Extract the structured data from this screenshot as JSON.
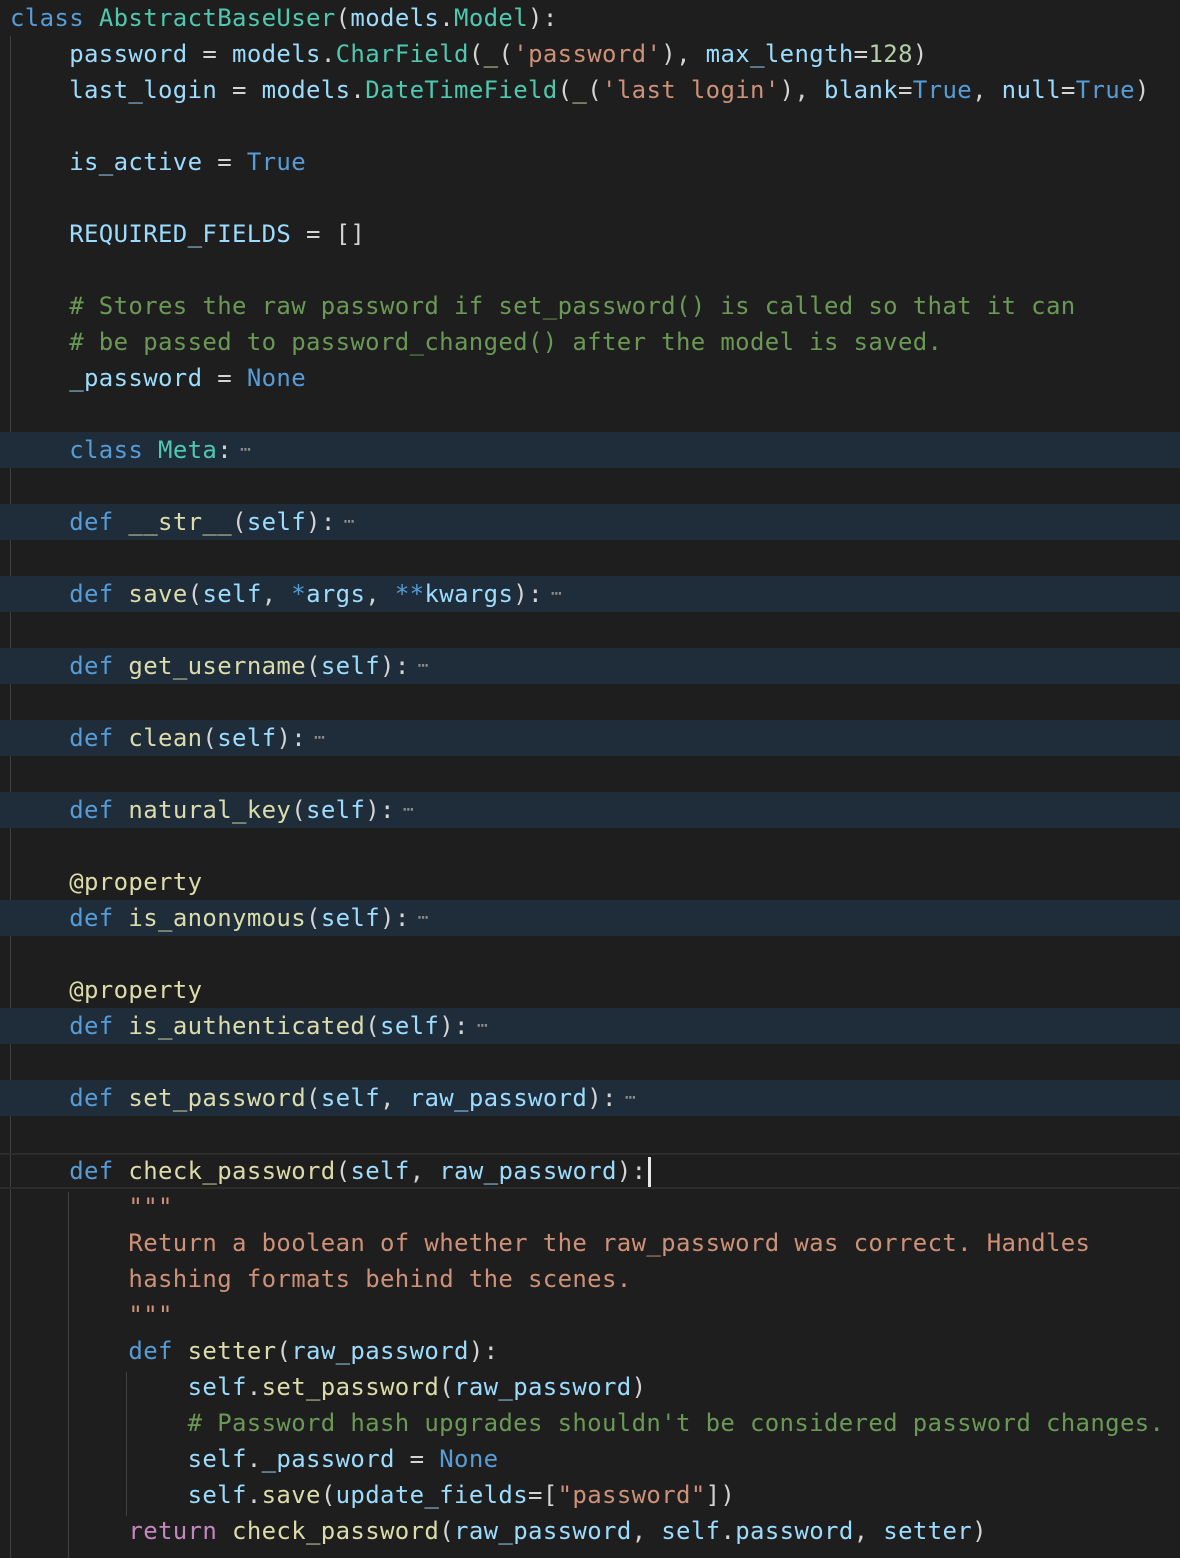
{
  "editor": {
    "language": "python",
    "theme": {
      "background": "#1e1e1e",
      "folded_highlight": "#1f2c3a",
      "keyword": "#569cd6",
      "class_name": "#4ec9b0",
      "function": "#dcdcaa",
      "variable": "#9cdcfe",
      "string": "#ce9178",
      "number": "#b5cea8",
      "comment": "#6a9955",
      "control": "#c586c0"
    },
    "fold_marker": "⋯",
    "lines": [
      {
        "tokens": [
          [
            "kw",
            "class"
          ],
          [
            "punc",
            " "
          ],
          [
            "cls",
            "AbstractBaseUser"
          ],
          [
            "punc",
            "("
          ],
          [
            "var",
            "models"
          ],
          [
            "punc",
            "."
          ],
          [
            "cls",
            "Model"
          ],
          [
            "punc",
            "):"
          ]
        ]
      },
      {
        "tokens": [
          [
            "punc",
            "    "
          ],
          [
            "var",
            "password"
          ],
          [
            "punc",
            " = "
          ],
          [
            "var",
            "models"
          ],
          [
            "punc",
            "."
          ],
          [
            "cls",
            "CharField"
          ],
          [
            "punc",
            "("
          ],
          [
            "fn",
            "_"
          ],
          [
            "punc",
            "("
          ],
          [
            "str",
            "'password'"
          ],
          [
            "punc",
            "), "
          ],
          [
            "var",
            "max_length"
          ],
          [
            "punc",
            "="
          ],
          [
            "num",
            "128"
          ],
          [
            "punc",
            ")"
          ]
        ]
      },
      {
        "tokens": [
          [
            "punc",
            "    "
          ],
          [
            "var",
            "last_login"
          ],
          [
            "punc",
            " = "
          ],
          [
            "var",
            "models"
          ],
          [
            "punc",
            "."
          ],
          [
            "cls",
            "DateTimeField"
          ],
          [
            "punc",
            "("
          ],
          [
            "fn",
            "_"
          ],
          [
            "punc",
            "("
          ],
          [
            "str",
            "'last login'"
          ],
          [
            "punc",
            "), "
          ],
          [
            "var",
            "blank"
          ],
          [
            "punc",
            "="
          ],
          [
            "kw",
            "True"
          ],
          [
            "punc",
            ", "
          ],
          [
            "var",
            "null"
          ],
          [
            "punc",
            "="
          ],
          [
            "kw",
            "True"
          ],
          [
            "punc",
            ")"
          ]
        ]
      },
      {
        "tokens": []
      },
      {
        "tokens": [
          [
            "punc",
            "    "
          ],
          [
            "var",
            "is_active"
          ],
          [
            "punc",
            " = "
          ],
          [
            "kw",
            "True"
          ]
        ]
      },
      {
        "tokens": []
      },
      {
        "tokens": [
          [
            "punc",
            "    "
          ],
          [
            "var",
            "REQUIRED_FIELDS"
          ],
          [
            "punc",
            " = []"
          ]
        ]
      },
      {
        "tokens": []
      },
      {
        "tokens": [
          [
            "punc",
            "    "
          ],
          [
            "com",
            "# Stores the raw password if set_password() is called so that it can"
          ]
        ]
      },
      {
        "tokens": [
          [
            "punc",
            "    "
          ],
          [
            "com",
            "# be passed to password_changed() after the model is saved."
          ]
        ]
      },
      {
        "tokens": [
          [
            "punc",
            "    "
          ],
          [
            "var",
            "_password"
          ],
          [
            "punc",
            " = "
          ],
          [
            "kw",
            "None"
          ]
        ]
      },
      {
        "tokens": []
      },
      {
        "folded": true,
        "tokens": [
          [
            "punc",
            "    "
          ],
          [
            "kw",
            "class"
          ],
          [
            "punc",
            " "
          ],
          [
            "cls",
            "Meta"
          ],
          [
            "punc",
            ":"
          ]
        ]
      },
      {
        "tokens": []
      },
      {
        "folded": true,
        "tokens": [
          [
            "punc",
            "    "
          ],
          [
            "kw",
            "def"
          ],
          [
            "punc",
            " "
          ],
          [
            "fn",
            "__str__"
          ],
          [
            "punc",
            "("
          ],
          [
            "var",
            "self"
          ],
          [
            "punc",
            "):"
          ]
        ]
      },
      {
        "tokens": []
      },
      {
        "folded": true,
        "tokens": [
          [
            "punc",
            "    "
          ],
          [
            "kw",
            "def"
          ],
          [
            "punc",
            " "
          ],
          [
            "fn",
            "save"
          ],
          [
            "punc",
            "("
          ],
          [
            "var",
            "self"
          ],
          [
            "punc",
            ", "
          ],
          [
            "kw",
            "*"
          ],
          [
            "var",
            "args"
          ],
          [
            "punc",
            ", "
          ],
          [
            "kw",
            "**"
          ],
          [
            "var",
            "kwargs"
          ],
          [
            "punc",
            "):"
          ]
        ]
      },
      {
        "tokens": []
      },
      {
        "folded": true,
        "tokens": [
          [
            "punc",
            "    "
          ],
          [
            "kw",
            "def"
          ],
          [
            "punc",
            " "
          ],
          [
            "fn",
            "get_username"
          ],
          [
            "punc",
            "("
          ],
          [
            "var",
            "self"
          ],
          [
            "punc",
            "):"
          ]
        ]
      },
      {
        "tokens": []
      },
      {
        "folded": true,
        "tokens": [
          [
            "punc",
            "    "
          ],
          [
            "kw",
            "def"
          ],
          [
            "punc",
            " "
          ],
          [
            "fn",
            "clean"
          ],
          [
            "punc",
            "("
          ],
          [
            "var",
            "self"
          ],
          [
            "punc",
            "):"
          ]
        ]
      },
      {
        "tokens": []
      },
      {
        "folded": true,
        "tokens": [
          [
            "punc",
            "    "
          ],
          [
            "kw",
            "def"
          ],
          [
            "punc",
            " "
          ],
          [
            "fn",
            "natural_key"
          ],
          [
            "punc",
            "("
          ],
          [
            "var",
            "self"
          ],
          [
            "punc",
            "):"
          ]
        ]
      },
      {
        "tokens": []
      },
      {
        "tokens": [
          [
            "punc",
            "    "
          ],
          [
            "dec",
            "@property"
          ]
        ]
      },
      {
        "folded": true,
        "tokens": [
          [
            "punc",
            "    "
          ],
          [
            "kw",
            "def"
          ],
          [
            "punc",
            " "
          ],
          [
            "fn",
            "is_anonymous"
          ],
          [
            "punc",
            "("
          ],
          [
            "var",
            "self"
          ],
          [
            "punc",
            "):"
          ]
        ]
      },
      {
        "tokens": []
      },
      {
        "tokens": [
          [
            "punc",
            "    "
          ],
          [
            "dec",
            "@property"
          ]
        ]
      },
      {
        "folded": true,
        "tokens": [
          [
            "punc",
            "    "
          ],
          [
            "kw",
            "def"
          ],
          [
            "punc",
            " "
          ],
          [
            "fn",
            "is_authenticated"
          ],
          [
            "punc",
            "("
          ],
          [
            "var",
            "self"
          ],
          [
            "punc",
            "):"
          ]
        ]
      },
      {
        "tokens": []
      },
      {
        "folded": true,
        "tokens": [
          [
            "punc",
            "    "
          ],
          [
            "kw",
            "def"
          ],
          [
            "punc",
            " "
          ],
          [
            "fn",
            "set_password"
          ],
          [
            "punc",
            "("
          ],
          [
            "var",
            "self"
          ],
          [
            "punc",
            ", "
          ],
          [
            "var",
            "raw_password"
          ],
          [
            "punc",
            "):"
          ]
        ]
      },
      {
        "tokens": []
      },
      {
        "current": true,
        "cursor": true,
        "tokens": [
          [
            "punc",
            "    "
          ],
          [
            "kw",
            "def"
          ],
          [
            "punc",
            " "
          ],
          [
            "fn",
            "check_password"
          ],
          [
            "punc",
            "("
          ],
          [
            "var",
            "self"
          ],
          [
            "punc",
            ", "
          ],
          [
            "var",
            "raw_password"
          ],
          [
            "punc",
            "):"
          ]
        ]
      },
      {
        "tokens": [
          [
            "punc",
            "        "
          ],
          [
            "str",
            "\"\"\""
          ]
        ]
      },
      {
        "tokens": [
          [
            "punc",
            "        "
          ],
          [
            "str",
            "Return a boolean of whether the raw_password was correct. Handles"
          ]
        ]
      },
      {
        "tokens": [
          [
            "punc",
            "        "
          ],
          [
            "str",
            "hashing formats behind the scenes."
          ]
        ]
      },
      {
        "tokens": [
          [
            "punc",
            "        "
          ],
          [
            "str",
            "\"\"\""
          ]
        ]
      },
      {
        "tokens": [
          [
            "punc",
            "        "
          ],
          [
            "kw",
            "def"
          ],
          [
            "punc",
            " "
          ],
          [
            "fn",
            "setter"
          ],
          [
            "punc",
            "("
          ],
          [
            "var",
            "raw_password"
          ],
          [
            "punc",
            "):"
          ]
        ]
      },
      {
        "tokens": [
          [
            "punc",
            "            "
          ],
          [
            "var",
            "self"
          ],
          [
            "punc",
            "."
          ],
          [
            "fn",
            "set_password"
          ],
          [
            "punc",
            "("
          ],
          [
            "var",
            "raw_password"
          ],
          [
            "punc",
            ")"
          ]
        ]
      },
      {
        "tokens": [
          [
            "punc",
            "            "
          ],
          [
            "com",
            "# Password hash upgrades shouldn't be considered password changes."
          ]
        ]
      },
      {
        "tokens": [
          [
            "punc",
            "            "
          ],
          [
            "var",
            "self"
          ],
          [
            "punc",
            "."
          ],
          [
            "var",
            "_password"
          ],
          [
            "punc",
            " = "
          ],
          [
            "kw",
            "None"
          ]
        ]
      },
      {
        "tokens": [
          [
            "punc",
            "            "
          ],
          [
            "var",
            "self"
          ],
          [
            "punc",
            "."
          ],
          [
            "fn",
            "save"
          ],
          [
            "punc",
            "("
          ],
          [
            "var",
            "update_fields"
          ],
          [
            "punc",
            "=["
          ],
          [
            "str",
            "\"password\""
          ],
          [
            "punc",
            "])"
          ]
        ]
      },
      {
        "tokens": [
          [
            "punc",
            "        "
          ],
          [
            "ctl",
            "return"
          ],
          [
            "punc",
            " "
          ],
          [
            "fn",
            "check_password"
          ],
          [
            "punc",
            "("
          ],
          [
            "var",
            "raw_password"
          ],
          [
            "punc",
            ", "
          ],
          [
            "var",
            "self"
          ],
          [
            "punc",
            "."
          ],
          [
            "var",
            "password"
          ],
          [
            "punc",
            ", "
          ],
          [
            "var",
            "setter"
          ],
          [
            "punc",
            ")"
          ]
        ]
      }
    ]
  }
}
